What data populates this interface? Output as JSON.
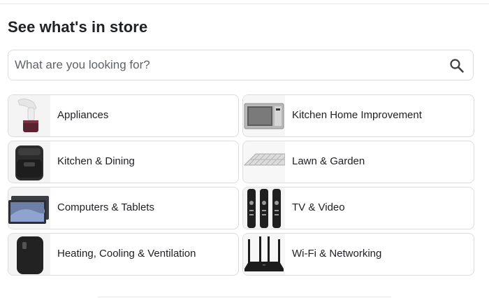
{
  "title": "See what's in store",
  "search": {
    "placeholder": "What are you looking for?",
    "value": "",
    "icon": "search-icon"
  },
  "categories": [
    {
      "label": "Appliances",
      "icon": "garment-steamer-image"
    },
    {
      "label": "Kitchen Home Improvement",
      "icon": "microwave-image"
    },
    {
      "label": "Kitchen & Dining",
      "icon": "air-fryer-image"
    },
    {
      "label": "Lawn & Garden",
      "icon": "wire-shelf-image"
    },
    {
      "label": "Computers & Tablets",
      "icon": "tablet-image"
    },
    {
      "label": "TV & Video",
      "icon": "remote-controls-image"
    },
    {
      "label": "Heating, Cooling & Ventilation",
      "icon": "heater-image"
    },
    {
      "label": "Wi-Fi & Networking",
      "icon": "wifi-router-image"
    }
  ]
}
